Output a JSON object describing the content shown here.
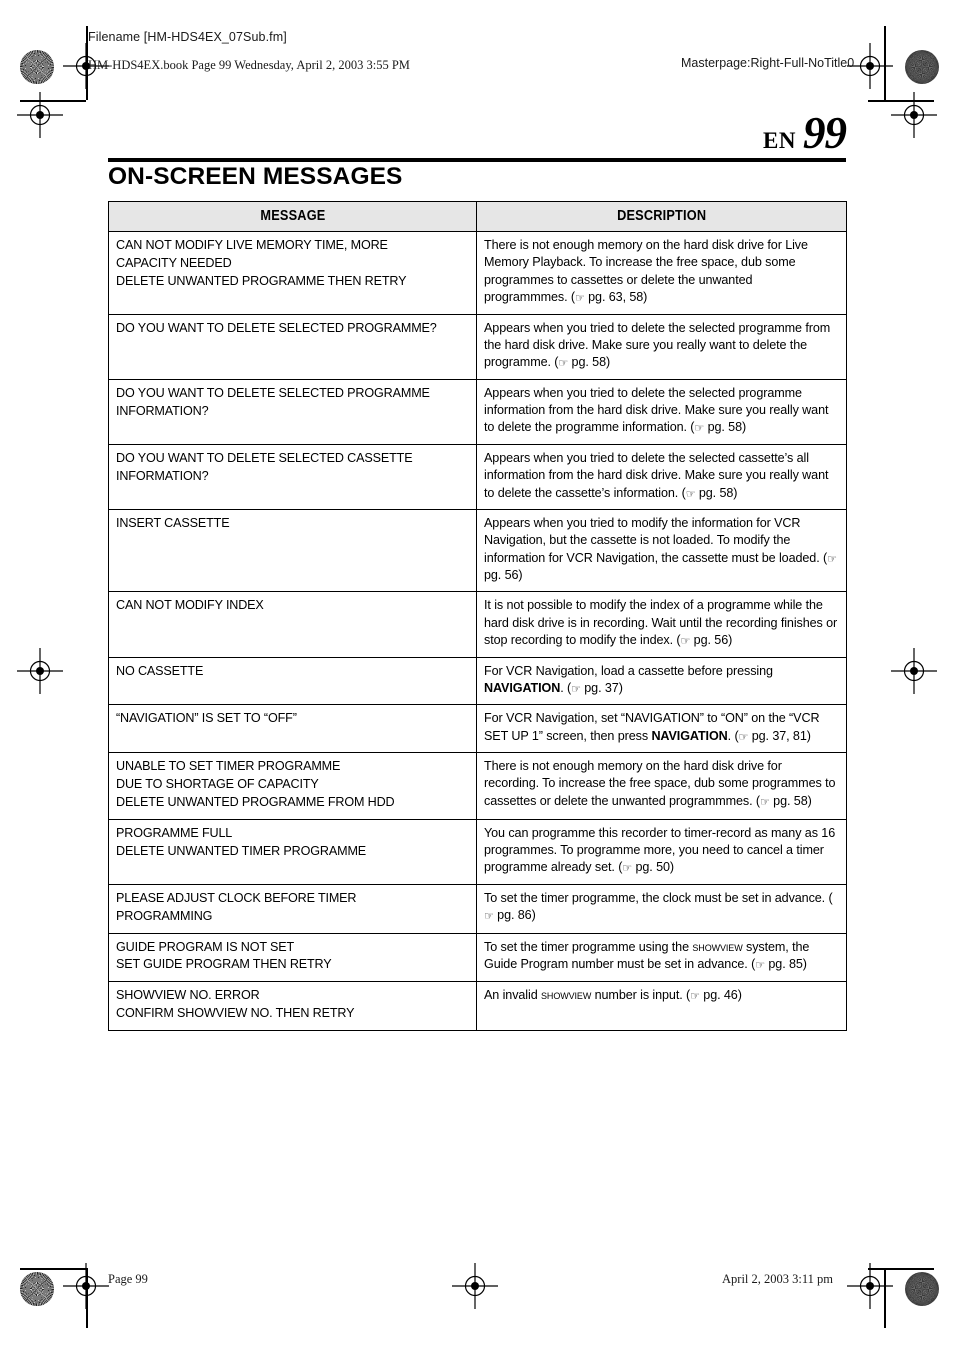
{
  "slug": {
    "filename": "Filename [HM-HDS4EX_07Sub.fm]",
    "book_line": "HM-HDS4EX.book  Page 99  Wednesday, April 2, 2003  3:55 PM",
    "masterpage": "Masterpage:Right-Full-NoTitle0"
  },
  "header": {
    "language_code": "EN",
    "page_number": "99",
    "title": "ON-SCREEN MESSAGES"
  },
  "table": {
    "columns": {
      "message": "MESSAGE",
      "description": "DESCRIPTION"
    },
    "rows": [
      {
        "message_lines": [
          "CAN NOT MODIFY LIVE MEMORY TIME, MORE",
          "CAPACITY NEEDED",
          "DELETE UNWANTED PROGRAMME THEN RETRY"
        ],
        "description": "There is not enough memory on the hard disk drive for Live Memory Playback. To increase the free space, dub some programmes to cassettes or delete the unwanted programmmes.",
        "reference": "pg. 63, 58"
      },
      {
        "message_lines": [
          "DO YOU WANT TO DELETE SELECTED PROGRAMME?"
        ],
        "description": "Appears when you tried to delete the selected programme from the hard disk drive. Make sure you really want to delete the programme.",
        "reference": "pg. 58"
      },
      {
        "message_lines": [
          "DO YOU WANT TO DELETE SELECTED PROGRAMME",
          "INFORMATION?"
        ],
        "description": "Appears when you tried to delete the selected programme information from the hard disk drive. Make sure you really want to delete the programme information.",
        "reference": "pg. 58"
      },
      {
        "message_lines": [
          "DO YOU WANT TO DELETE SELECTED CASSETTE",
          "INFORMATION?"
        ],
        "description": "Appears when you tried to delete the selected cassette’s all information from the hard disk drive. Make sure you really want to delete the cassette’s information.",
        "reference": "pg. 58"
      },
      {
        "message_lines": [
          "INSERT CASSETTE"
        ],
        "description": "Appears when you tried to modify the information for VCR Navigation, but the cassette is not loaded. To modify the information for VCR Navigation, the cassette must be loaded.",
        "reference": "pg. 56"
      },
      {
        "message_lines": [
          "CAN NOT MODIFY INDEX"
        ],
        "description": "It is not possible to modify the index of a programme while the hard disk drive is in recording. Wait until the recording finishes or stop recording to modify the index.",
        "reference": "pg. 56"
      },
      {
        "message_lines": [
          "NO CASSETTE"
        ],
        "description": "For VCR Navigation, load a cassette before pressing ",
        "description_bold": "NAVIGATION",
        "description_tail": ".",
        "reference": "pg. 37"
      },
      {
        "message_lines": [
          "“NAVIGATION” IS SET TO “OFF”"
        ],
        "description": "For VCR Navigation, set “NAVIGATION” to “ON” on the “VCR SET UP 1” screen, then press ",
        "description_bold": "NAVIGATION",
        "description_tail": ".",
        "reference": "pg. 37, 81"
      },
      {
        "message_lines": [
          "UNABLE TO SET TIMER PROGRAMME",
          "DUE TO SHORTAGE OF CAPACITY",
          "DELETE UNWANTED PROGRAMME FROM HDD"
        ],
        "description": "There is not enough memory on the hard disk drive for recording. To increase the free space, dub some programmes to cassettes or delete the unwanted programmmes.",
        "reference": "pg. 58"
      },
      {
        "message_lines": [
          "PROGRAMME FULL",
          "DELETE UNWANTED TIMER PROGRAMME"
        ],
        "description": "You can programme this recorder to timer-record as many as 16 programmes. To programme more, you need to cancel a timer programme already set.",
        "reference": "pg. 50"
      },
      {
        "message_lines": [
          "PLEASE ADJUST CLOCK BEFORE TIMER",
          "PROGRAMMING"
        ],
        "description": "To set the timer programme, the clock must be set in advance.",
        "reference": "pg. 86"
      },
      {
        "message_lines": [
          "GUIDE PROGRAM IS NOT SET",
          "SET GUIDE PROGRAM THEN RETRY"
        ],
        "description_pre": "To set the timer programme using the ",
        "description_smallcaps": "SHOWVIEW",
        "description_post": " system, the Guide Program number must be set in advance.",
        "reference": "pg. 85"
      },
      {
        "message_lines": [
          "SHOWVIEW NO. ERROR",
          "CONFIRM SHOWVIEW NO. THEN RETRY"
        ],
        "description_pre": "An invalid ",
        "description_smallcaps": "SHOWVIEW",
        "description_post": " number is input.",
        "reference": "pg. 46"
      }
    ]
  },
  "footer": {
    "page_label": "Page 99",
    "date_label": "April 2, 2003 3:11 pm"
  },
  "icons": {
    "reference_hand": "☞"
  }
}
